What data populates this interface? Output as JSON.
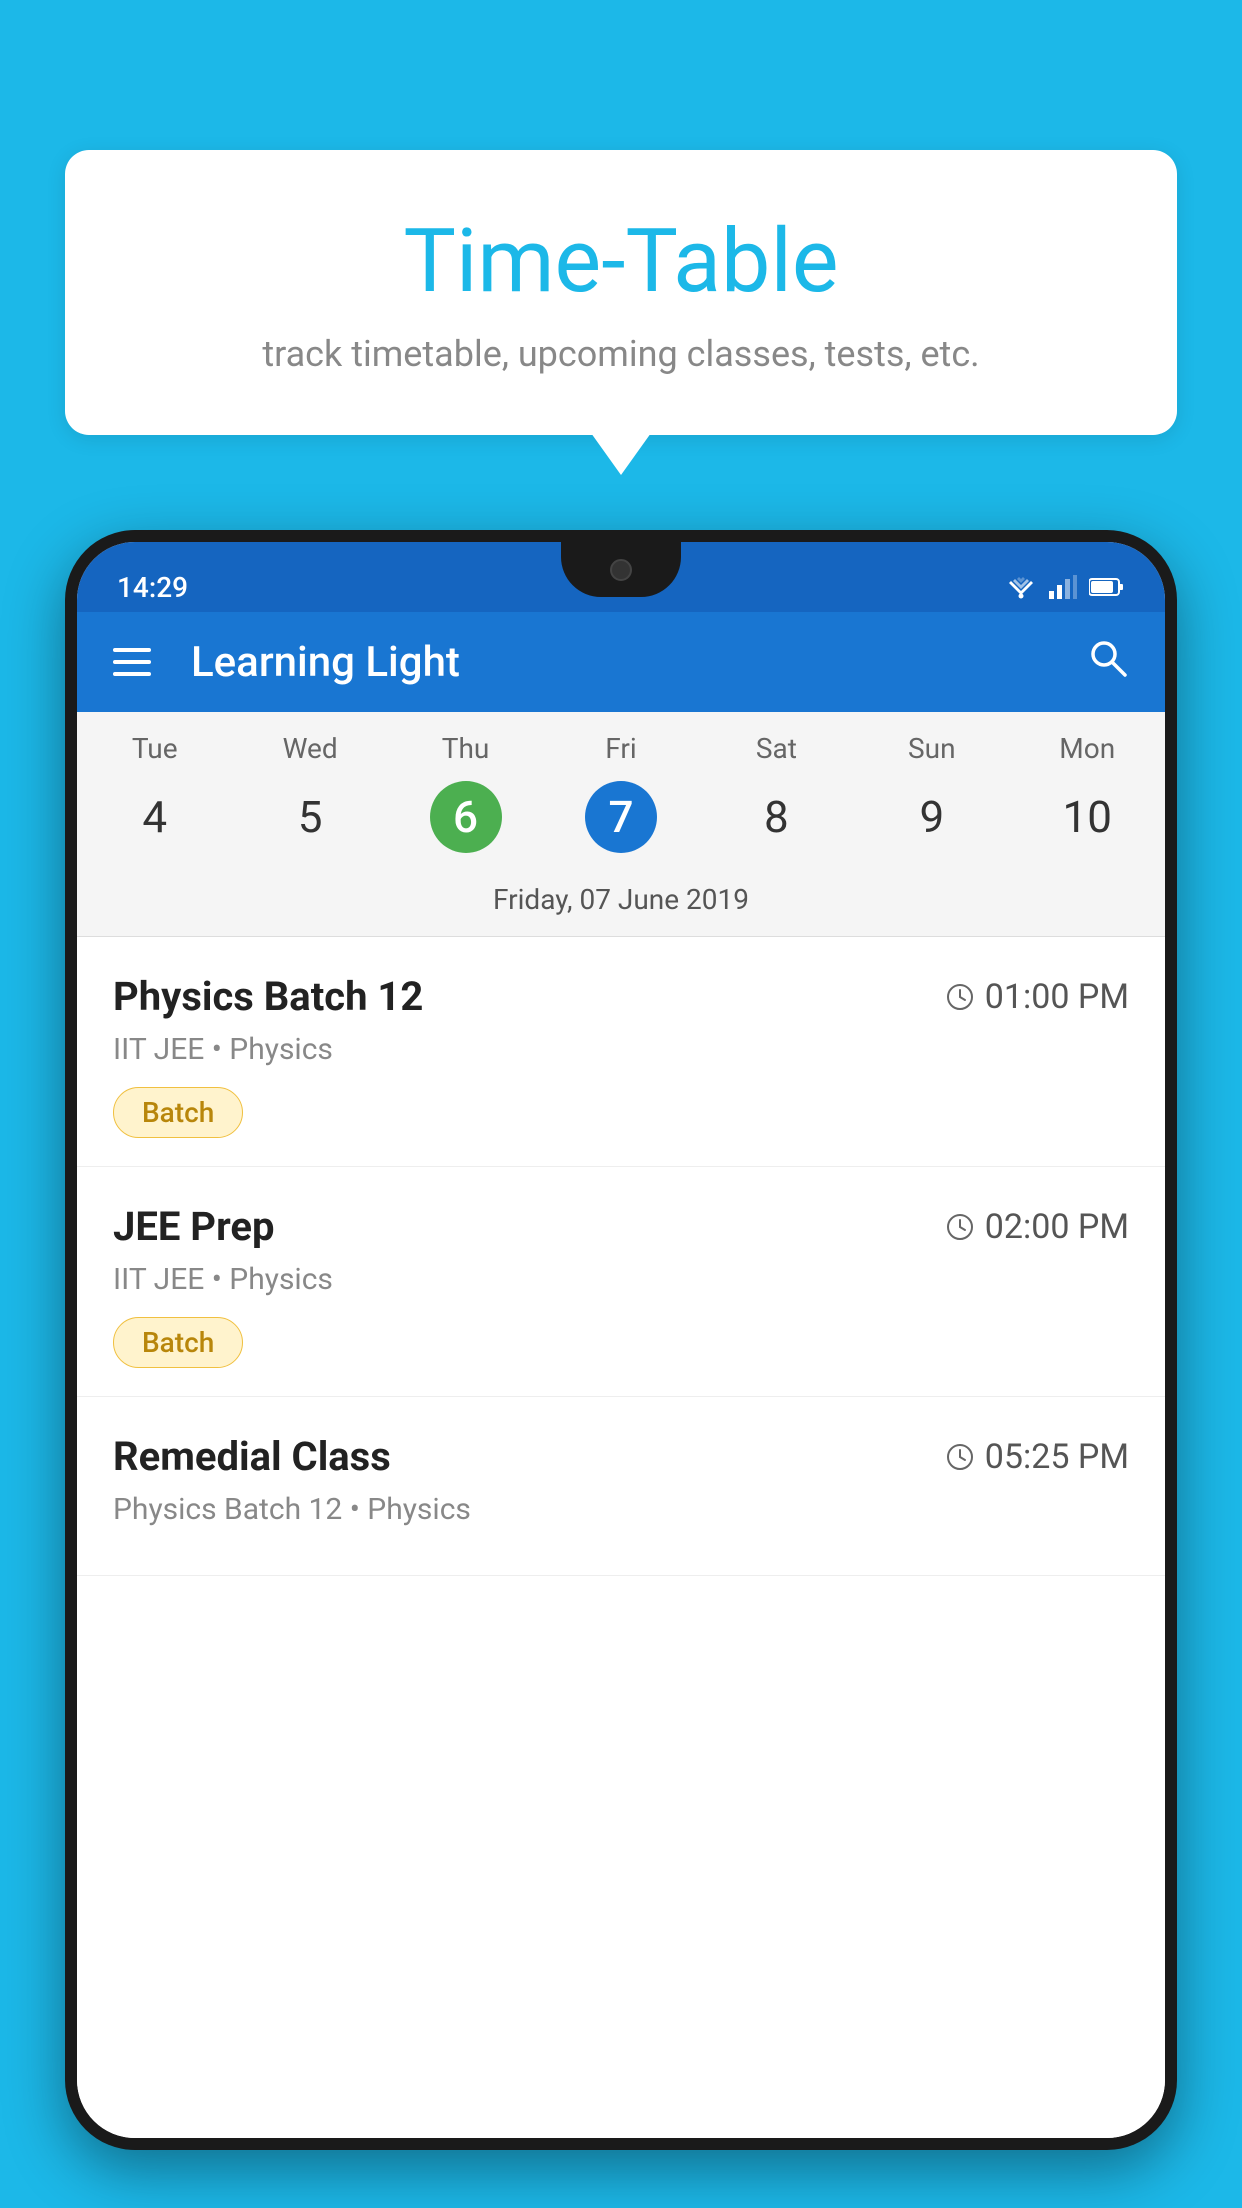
{
  "background_color": "#1CB8E8",
  "bubble": {
    "title": "Time-Table",
    "subtitle": "track timetable, upcoming classes, tests, etc."
  },
  "app": {
    "name": "Learning Light",
    "status_time": "14:29"
  },
  "calendar": {
    "days": [
      "Tue",
      "Wed",
      "Thu",
      "Fri",
      "Sat",
      "Sun",
      "Mon"
    ],
    "dates": [
      "4",
      "5",
      "6",
      "7",
      "8",
      "9",
      "10"
    ],
    "today_index": 2,
    "selected_index": 3,
    "selected_label": "Friday, 07 June 2019"
  },
  "classes": [
    {
      "name": "Physics Batch 12",
      "time": "01:00 PM",
      "meta": "IIT JEE • Physics",
      "badge": "Batch"
    },
    {
      "name": "JEE Prep",
      "time": "02:00 PM",
      "meta": "IIT JEE • Physics",
      "badge": "Batch"
    },
    {
      "name": "Remedial Class",
      "time": "05:25 PM",
      "meta": "Physics Batch 12 • Physics",
      "badge": null
    }
  ]
}
